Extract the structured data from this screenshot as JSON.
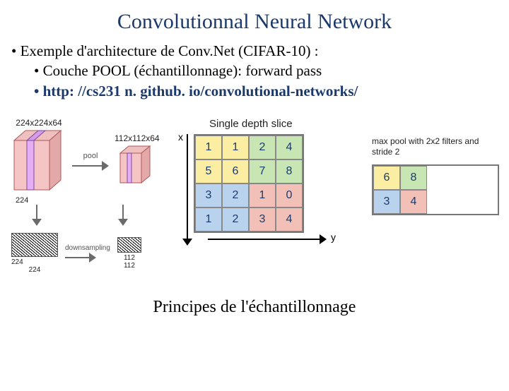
{
  "title": "Convolutionnal Neural Network",
  "bullets": {
    "b1": "Exemple d'architecture de Conv.Net  (CIFAR-10) :",
    "b2": "Couche POOL (échantillonnage): forward pass",
    "b3_link": "http: //cs231 n. github. io/convolutional-networks/"
  },
  "left_diagram": {
    "in_dims": "224x224x64",
    "out_dims": "112x112x64",
    "pool_label": "pool",
    "downsample_label": "downsampling",
    "in_h": "224",
    "in_w": "224",
    "out_h": "112",
    "out_w": "112"
  },
  "center": {
    "header": "Single depth slice",
    "x_label": "x",
    "y_label": "y",
    "grid": [
      [
        1,
        1,
        2,
        4
      ],
      [
        5,
        6,
        7,
        8
      ],
      [
        3,
        2,
        1,
        0
      ],
      [
        1,
        2,
        3,
        4
      ]
    ]
  },
  "right": {
    "note": "max pool with 2x2 filters and stride 2",
    "grid": [
      [
        6,
        8
      ],
      [
        3,
        4
      ]
    ]
  },
  "caption": "Principes de l'échantillonnage",
  "chart_data": {
    "type": "table",
    "title": "Max pooling 2x2 stride 2",
    "input": [
      [
        1,
        1,
        2,
        4
      ],
      [
        5,
        6,
        7,
        8
      ],
      [
        3,
        2,
        1,
        0
      ],
      [
        1,
        2,
        3,
        4
      ]
    ],
    "output": [
      [
        6,
        8
      ],
      [
        3,
        4
      ]
    ],
    "quadrant_colors": [
      "#fbeea3",
      "#c7e6b3",
      "#b9d3ef",
      "#f3c0b8"
    ]
  }
}
